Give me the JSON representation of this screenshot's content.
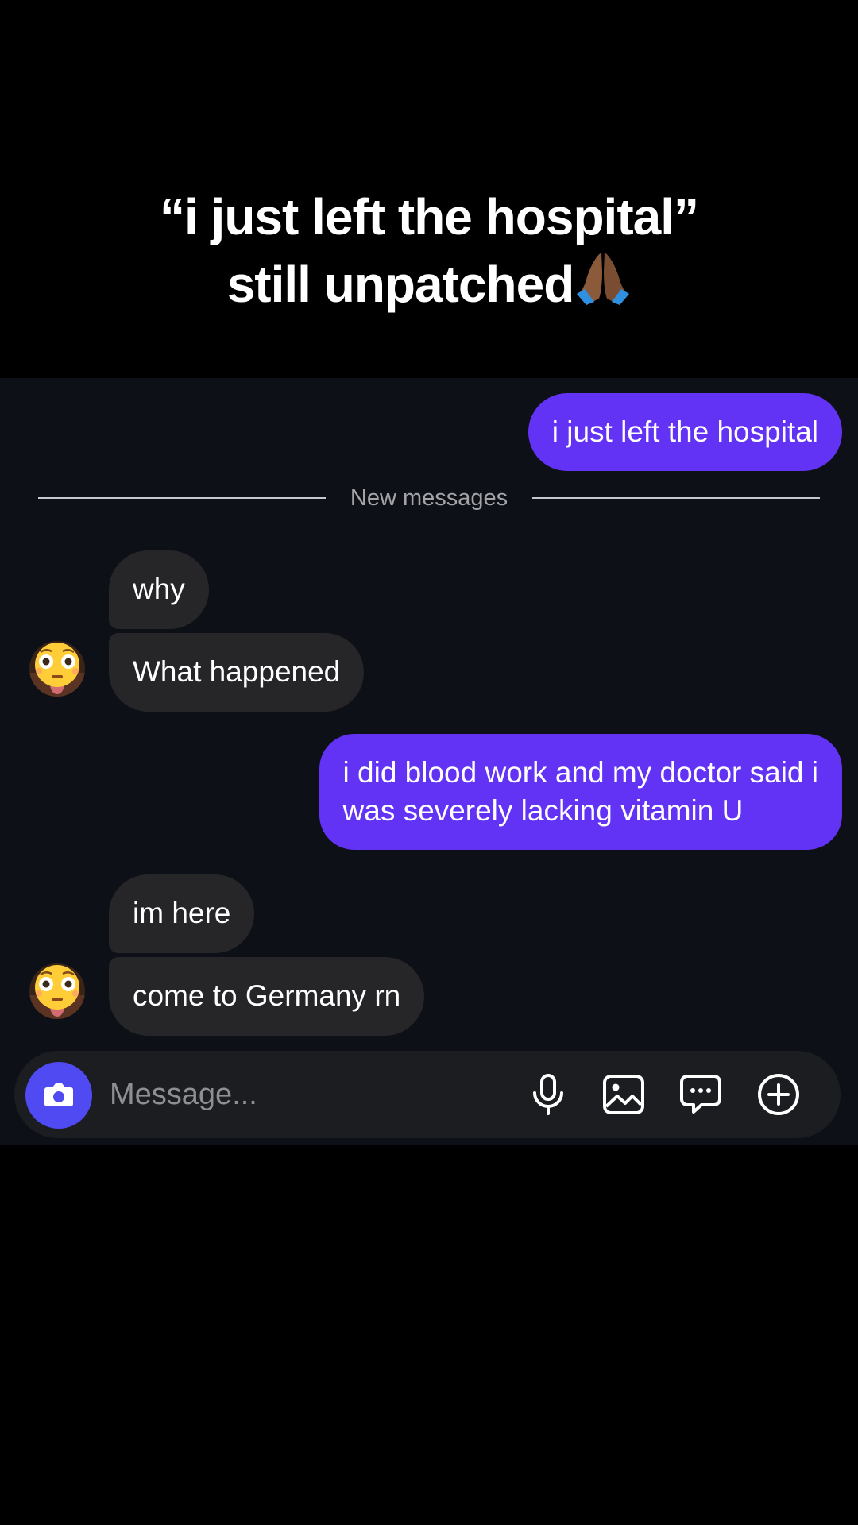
{
  "caption": {
    "line1": "“i just left the hospital”",
    "line2": "still unpatched",
    "emoji": "🙏🏾"
  },
  "chat": {
    "divider_label": "New messages",
    "messages": [
      {
        "from": "me",
        "text": "i just left the hospital"
      },
      {
        "from": "them",
        "text": "why"
      },
      {
        "from": "them",
        "text": "What happened"
      },
      {
        "from": "me",
        "lines": [
          "i did blood work and my doctor said i",
          "was severely lacking vitamin U"
        ]
      },
      {
        "from": "them",
        "text": "im here"
      },
      {
        "from": "them",
        "text": "come to Germany rn"
      }
    ]
  },
  "composer": {
    "placeholder": "Message..."
  },
  "icons": {
    "camera": "camera-icon",
    "mic": "microphone-icon",
    "gallery": "gallery-icon",
    "sticker": "chat-bubble-icon",
    "plus": "plus-circle-icon",
    "avatar": "flushed-face-avatar",
    "emoji": "folded-hands-emoji"
  },
  "colors": {
    "sent_bubble": "#6333f5",
    "received_bubble": "#262629",
    "chat_background": "#0d1016",
    "camera_button": "#4f4af2"
  }
}
